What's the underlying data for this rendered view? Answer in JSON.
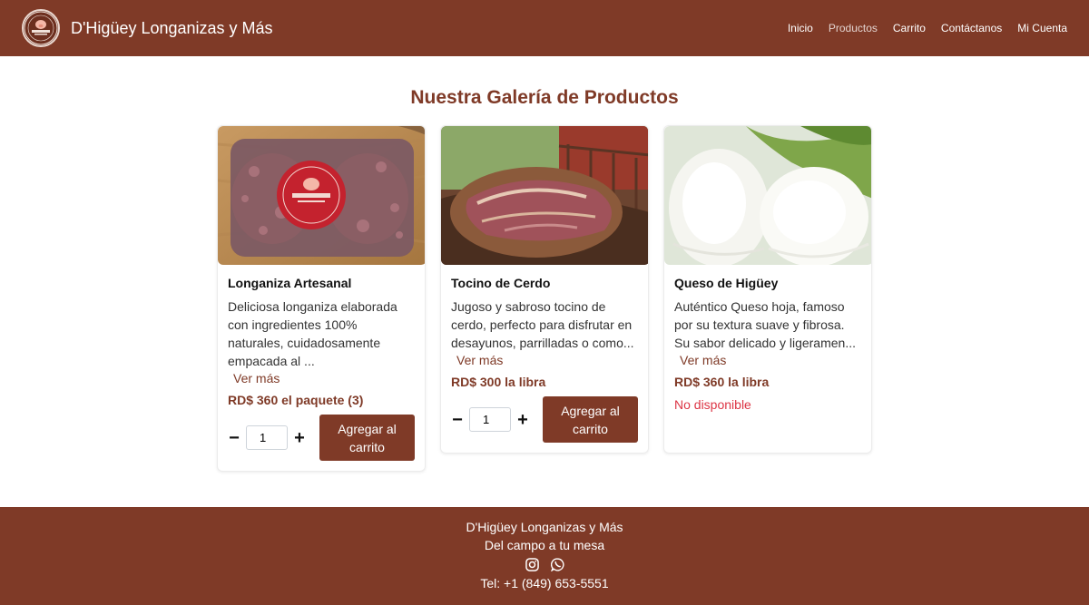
{
  "navbar": {
    "brand": "D'Higüey Longanizas y Más",
    "logo_text": "CALIDAD Y SABOR",
    "links": [
      "Inicio",
      "Productos",
      "Carrito",
      "Contáctanos",
      "Mi Cuenta"
    ],
    "active": "Productos"
  },
  "page": {
    "title": "Nuestra Galería de Productos"
  },
  "products": [
    {
      "name": "Longaniza Artesanal",
      "description": "Deliciosa longaniza elaborada con ingredientes 100% naturales, cuidadosamente empacada al ...",
      "more": "Ver más",
      "price": "RD$ 360 el paquete (3)",
      "quantity": "1",
      "add_label": "Agregar al carrito",
      "available": true
    },
    {
      "name": "Tocino de Cerdo",
      "description": "Jugoso y sabroso tocino de cerdo, perfecto para disfrutar en desayunos, parrilladas o como...",
      "more": "Ver más",
      "price": "RD$ 300 la libra",
      "quantity": "1",
      "add_label": "Agregar al carrito",
      "available": true
    },
    {
      "name": "Queso de Higüey",
      "description": "Auténtico Queso hoja, famoso por su textura suave y fibrosa. Su sabor delicado y ligeramen...",
      "more": "Ver más",
      "price": "RD$ 360 la libra",
      "status": "No disponible",
      "available": false
    }
  ],
  "footer": {
    "name": "D'Higüey Longanizas y Más",
    "slogan": "Del campo a tu mesa",
    "phone": "Tel: +1 (849) 653-5551",
    "icons": [
      "instagram-icon",
      "whatsapp-icon"
    ]
  },
  "colors": {
    "brand": "#7f3a27",
    "danger": "#dc3545"
  }
}
